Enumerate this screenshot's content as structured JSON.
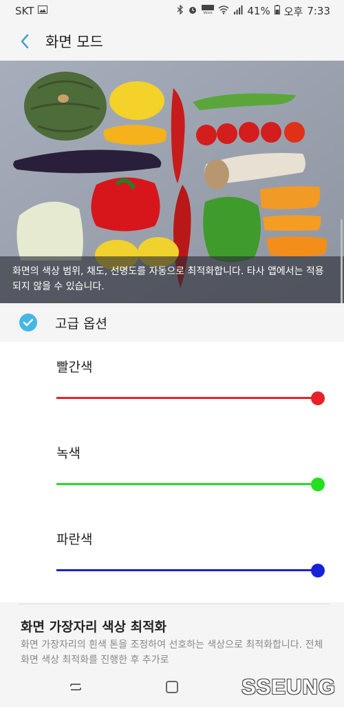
{
  "status_bar": {
    "carrier": "SKT",
    "battery": "41%",
    "ampm": "오후",
    "time": "7:33",
    "icons": [
      "image-icon",
      "bluetooth-icon",
      "alarm-icon",
      "volte-icon",
      "wifi-icon",
      "signal-icon",
      "battery-icon"
    ]
  },
  "app_bar": {
    "title": "화면 모드",
    "back_icon": "chevron-left-icon",
    "accent": "#4a9fc8"
  },
  "hero": {
    "caption": "화면의 색상 범위, 채도, 선명도를 자동으로 최적화합니다. 타사 앱에서는 적용되지 않을 수 있습니다."
  },
  "advanced": {
    "label": "고급 옵션",
    "checked": true,
    "color": "#45b6e6"
  },
  "sliders": [
    {
      "label": "빨간색",
      "color": "#e8202a",
      "value": 1.0
    },
    {
      "label": "녹색",
      "color": "#22e020",
      "value": 1.0
    },
    {
      "label": "파란색",
      "color": "#1820d8",
      "value": 1.0
    }
  ],
  "edge": {
    "title": "화면 가장자리 색상 최적화",
    "description": "화면 가장자리의 흰색 톤을 조정하여 선호하는 색상으로 최적화합니다. 전체 화면 색상 최적화를 진행한 후 추가로"
  },
  "nav_bar": {
    "recent_icon": "recent-apps-icon",
    "home_icon": "home-icon",
    "logo": "SSEUNG"
  }
}
